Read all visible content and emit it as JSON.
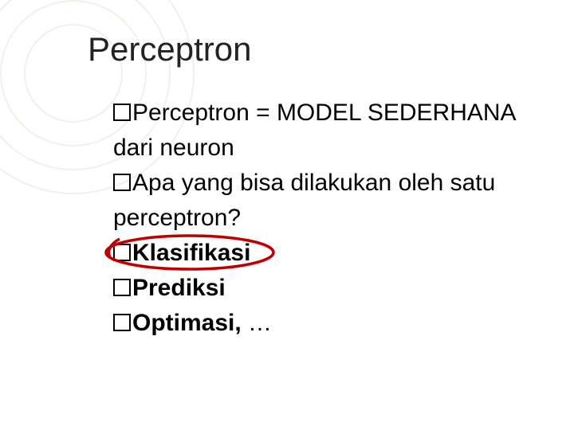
{
  "title": "Perceptron",
  "bullets": [
    {
      "prefix": "Perceptron",
      "rest": " = MODEL SEDERHANA dari neuron",
      "bold_prefix": false,
      "bold_rest": false,
      "circled": false,
      "wrap_second_line": true
    },
    {
      "prefix": "Apa",
      "rest": " yang bisa dilakukan oleh satu perceptron?",
      "bold_prefix": false,
      "bold_rest": false,
      "circled": false,
      "wrap_second_line": true
    },
    {
      "prefix": "Klasifikasi",
      "rest": "",
      "bold_prefix": true,
      "bold_rest": false,
      "circled": true,
      "wrap_second_line": false
    },
    {
      "prefix": "Prediksi",
      "rest": "",
      "bold_prefix": true,
      "bold_rest": false,
      "circled": false,
      "wrap_second_line": false
    },
    {
      "prefix": "Optimasi, ",
      "rest": "…",
      "bold_prefix": true,
      "bold_rest": false,
      "circled": false,
      "wrap_second_line": false
    }
  ],
  "colors": {
    "text": "#000000",
    "circle": "#c00000",
    "deco": "rgba(190,170,120,0.18)"
  }
}
